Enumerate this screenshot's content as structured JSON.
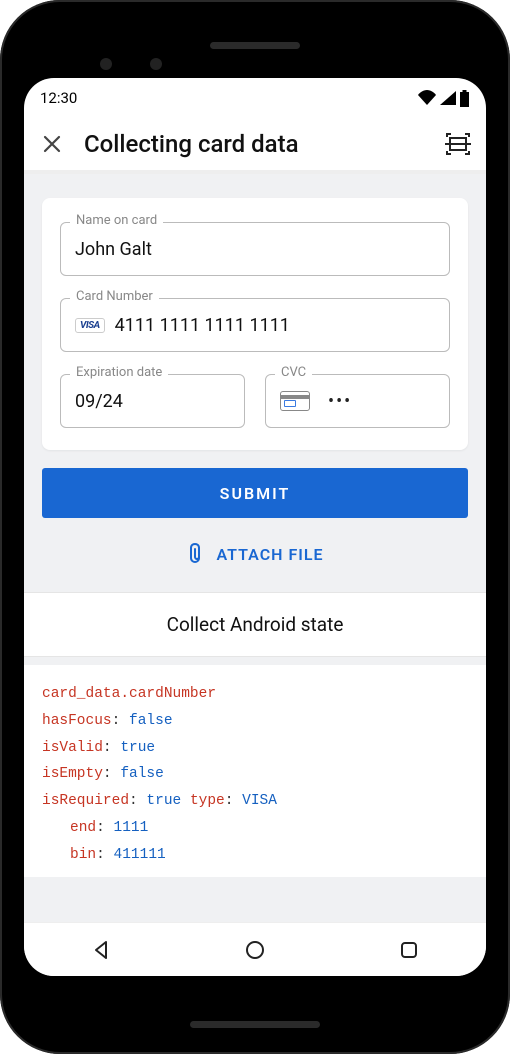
{
  "status": {
    "time": "12:30"
  },
  "appbar": {
    "title": "Collecting card data"
  },
  "form": {
    "name": {
      "label": "Name on card",
      "value": "John Galt"
    },
    "number": {
      "label": "Card Number",
      "brand": "VISA",
      "value": "4111 1111 1111 1111"
    },
    "expiry": {
      "label": "Expiration date",
      "value": "09/24"
    },
    "cvc": {
      "label": "CVC",
      "masked": "•••"
    }
  },
  "buttons": {
    "submit": "SUBMIT",
    "attach": "ATTACH FILE"
  },
  "state": {
    "title": "Collect Android state",
    "path": "card_data.cardNumber",
    "hasFocus_k": "hasFocus",
    "hasFocus_v": "false",
    "isValid_k": "isValid",
    "isValid_v": "true",
    "isEmpty_k": "isEmpty",
    "isEmpty_v": "false",
    "isRequired_k": "isRequired",
    "isRequired_v": "true",
    "type_k": "type",
    "type_v": "VISA",
    "end_k": "end",
    "end_v": "1111",
    "bin_k": "bin",
    "bin_v": "411111"
  }
}
